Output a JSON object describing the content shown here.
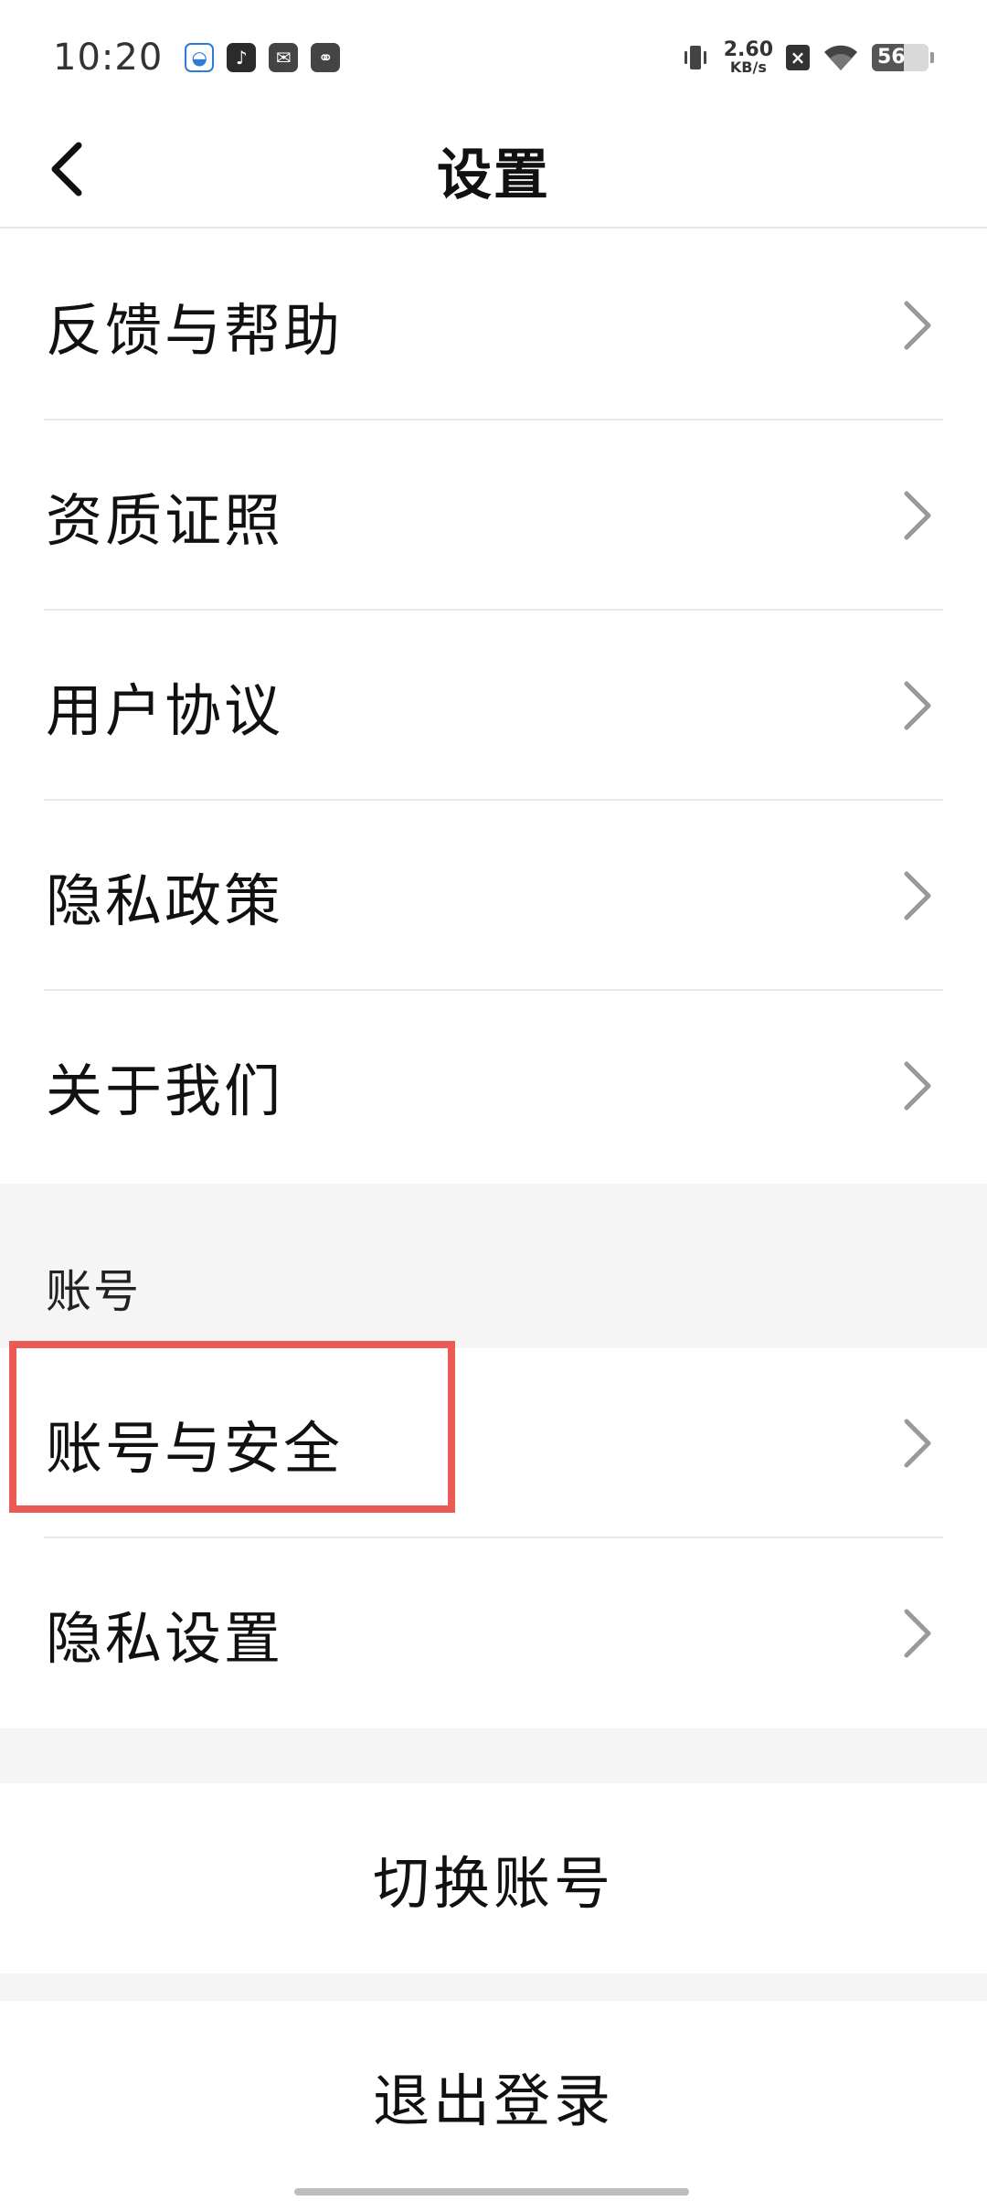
{
  "status_bar": {
    "time": "10:20",
    "net_speed_value": "2.60",
    "net_speed_unit": "KB/s",
    "battery_level": "56",
    "notification_icons": [
      "baidu-app-icon",
      "tiktok-icon",
      "mail-icon",
      "link-icon"
    ]
  },
  "header": {
    "title": "设置"
  },
  "list_general": [
    {
      "label": "反馈与帮助"
    },
    {
      "label": "资质证照"
    },
    {
      "label": "用户协议"
    },
    {
      "label": "隐私政策"
    },
    {
      "label": "关于我们"
    }
  ],
  "account_section": {
    "header": "账号",
    "items": [
      {
        "label": "账号与安全"
      },
      {
        "label": "隐私设置"
      }
    ]
  },
  "actions": {
    "switch_account": "切换账号",
    "logout": "退出登录"
  },
  "colors": {
    "highlight": "#ec5a55",
    "band": "#f5f5f5",
    "divider": "#e8e8e8"
  }
}
